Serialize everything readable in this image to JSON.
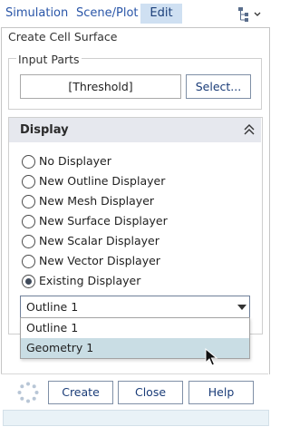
{
  "menu": {
    "simulation": "Simulation",
    "scene_plot": "Scene/Plot",
    "edit": "Edit",
    "tree_icon": "tree-view-icon"
  },
  "dialog": {
    "title": "Create Cell Surface",
    "input_parts": {
      "label": "Input Parts",
      "value": "[Threshold]",
      "select_label": "Select..."
    },
    "display": {
      "title": "Display",
      "collapse_icon": "double-chevron-up-icon",
      "options": [
        {
          "label": "No Displayer",
          "checked": false
        },
        {
          "label": "New Outline Displayer",
          "checked": false
        },
        {
          "label": "New Mesh Displayer",
          "checked": false
        },
        {
          "label": "New Surface Displayer",
          "checked": false
        },
        {
          "label": "New Scalar Displayer",
          "checked": false
        },
        {
          "label": "New Vector Displayer",
          "checked": false
        },
        {
          "label": "Existing Displayer",
          "checked": true
        }
      ],
      "selected_displayer": "Outline 1",
      "dropdown_items": [
        "Outline 1",
        "Geometry 1"
      ],
      "hovered_item": "Geometry 1"
    }
  },
  "footer": {
    "create": "Create",
    "close": "Close",
    "help": "Help",
    "spinner_icon": "busy-spinner-icon"
  },
  "colors": {
    "accent": "#2a56a8",
    "active_tab_bg": "#cfe0f2",
    "hover_item_bg": "#c9dde4",
    "header_bg": "#e6e8ee"
  }
}
